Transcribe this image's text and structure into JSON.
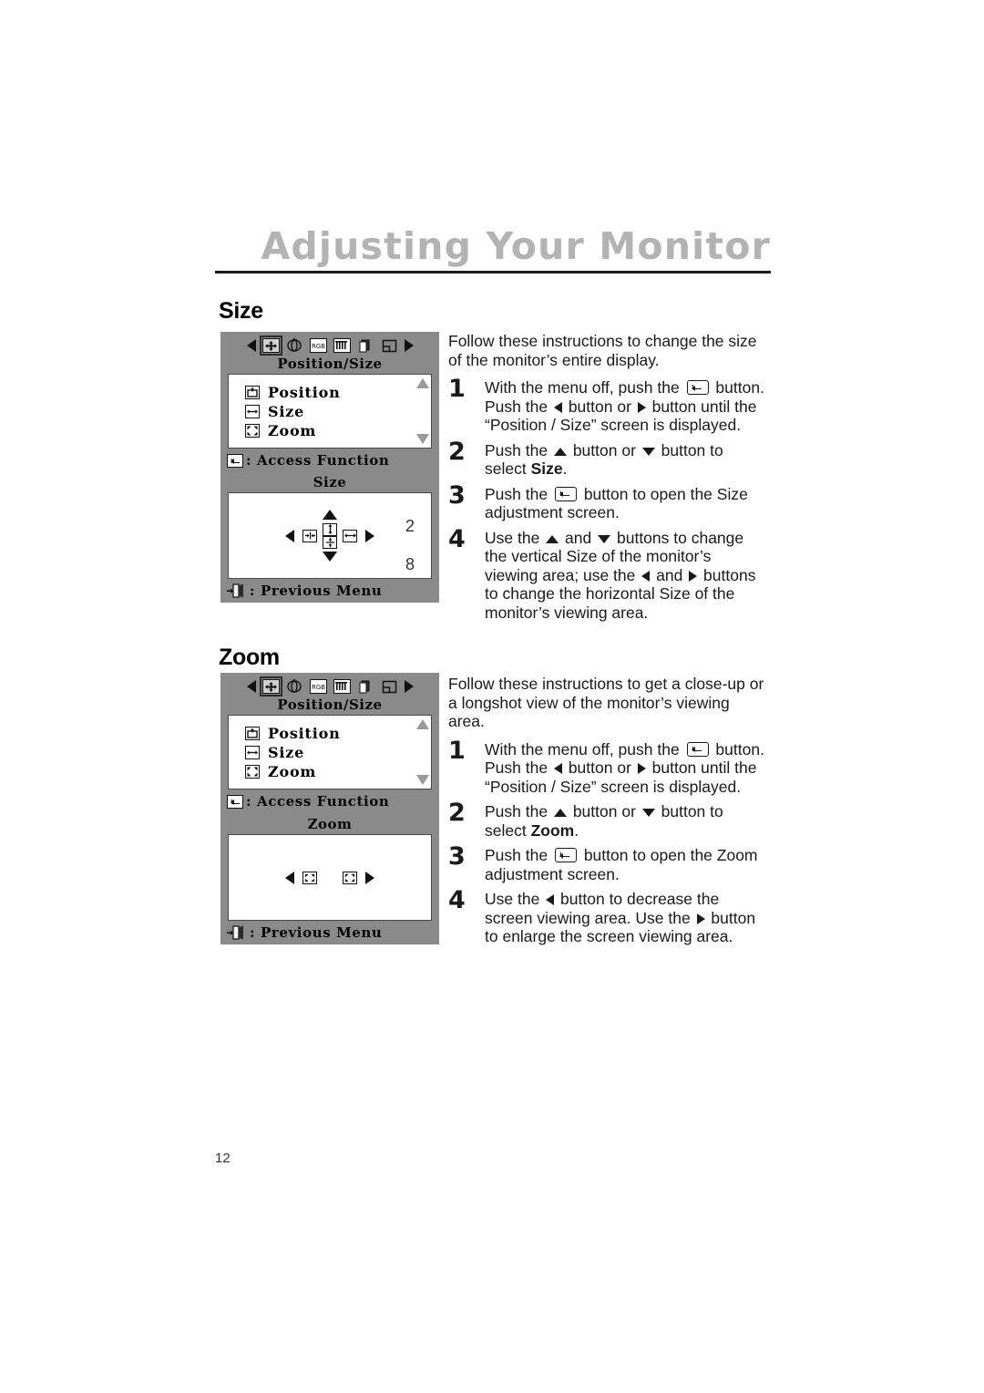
{
  "page": {
    "chapter_title": "Adjusting Your Monitor",
    "page_number": "12"
  },
  "sections": [
    {
      "heading": "Size",
      "lead": "Follow these instructions to change the size of the monitor’s entire display.",
      "menu_screen": {
        "title": "Position/Size",
        "icons": [
          "left-arrow",
          "position-size-icon",
          "geometry-icon",
          "rgb-icon",
          "moire-icon",
          "osd-icon",
          "screen-icon",
          "right-arrow"
        ],
        "selected_icon": "position-size-icon",
        "items": [
          {
            "label": "Position",
            "icon": "position-icon"
          },
          {
            "label": "Size",
            "icon": "size-icon"
          },
          {
            "label": "Zoom",
            "icon": "zoom-icon"
          }
        ],
        "footer": ": Access Function"
      },
      "adjust_screen": {
        "title": "Size",
        "footer": ": Previous Menu",
        "value_top": "2",
        "value_bottom": "8",
        "controls": [
          "v-expand",
          "h-shrink",
          "h-expand",
          "v-shrink"
        ]
      },
      "steps": [
        {
          "num": "1",
          "parts": [
            {
              "t": "With the menu off, push the "
            },
            {
              "g": "enter"
            },
            {
              "t": " button. Push the "
            },
            {
              "g": "left"
            },
            {
              "t": " button or "
            },
            {
              "g": "right"
            },
            {
              "t": " button until the “Position / Size” screen is displayed."
            }
          ]
        },
        {
          "num": "2",
          "parts": [
            {
              "t": "Push the "
            },
            {
              "g": "up"
            },
            {
              "t": " button or "
            },
            {
              "g": "down"
            },
            {
              "t": " button to select "
            },
            {
              "t": "Size",
              "b": true
            },
            {
              "t": "."
            }
          ]
        },
        {
          "num": "3",
          "parts": [
            {
              "t": "Push the "
            },
            {
              "g": "enter"
            },
            {
              "t": " button to open the Size adjustment screen."
            }
          ]
        },
        {
          "num": "4",
          "parts": [
            {
              "t": "Use the "
            },
            {
              "g": "up"
            },
            {
              "t": " and "
            },
            {
              "g": "down"
            },
            {
              "t": " buttons to change the vertical Size of the monitor’s viewing area; use the "
            },
            {
              "g": "left"
            },
            {
              "t": " and "
            },
            {
              "g": "right"
            },
            {
              "t": " buttons to change the horizontal Size of the monitor’s viewing area."
            }
          ]
        }
      ]
    },
    {
      "heading": "Zoom",
      "lead": "Follow these instructions to get a close-up or a longshot view of the monitor’s viewing area.",
      "menu_screen": {
        "title": "Position/Size",
        "icons": [
          "left-arrow",
          "position-size-icon",
          "geometry-icon",
          "rgb-icon",
          "moire-icon",
          "osd-icon",
          "screen-icon",
          "right-arrow"
        ],
        "selected_icon": "position-size-icon",
        "items": [
          {
            "label": "Position",
            "icon": "position-icon"
          },
          {
            "label": "Size",
            "icon": "size-icon"
          },
          {
            "label": "Zoom",
            "icon": "zoom-icon"
          }
        ],
        "footer": ": Access Function"
      },
      "adjust_screen": {
        "title": "Zoom",
        "footer": ": Previous Menu",
        "controls": [
          "zoom-out",
          "zoom-in"
        ]
      },
      "steps": [
        {
          "num": "1",
          "parts": [
            {
              "t": "With the menu off, push the "
            },
            {
              "g": "enter"
            },
            {
              "t": " button. Push the "
            },
            {
              "g": "left"
            },
            {
              "t": " button or "
            },
            {
              "g": "right"
            },
            {
              "t": " button until the “Position / Size” screen is displayed."
            }
          ]
        },
        {
          "num": "2",
          "parts": [
            {
              "t": "Push the "
            },
            {
              "g": "up"
            },
            {
              "t": " button or "
            },
            {
              "g": "down"
            },
            {
              "t": " button to select "
            },
            {
              "t": "Zoom",
              "b": true
            },
            {
              "t": "."
            }
          ]
        },
        {
          "num": "3",
          "parts": [
            {
              "t": "Push the "
            },
            {
              "g": "enter"
            },
            {
              "t": " button to open the Zoom adjustment screen."
            }
          ]
        },
        {
          "num": "4",
          "parts": [
            {
              "t": "Use the "
            },
            {
              "g": "left"
            },
            {
              "t": " button to decrease the screen viewing area. Use the "
            },
            {
              "g": "right"
            },
            {
              "t": " button to enlarge the screen viewing area."
            }
          ]
        }
      ]
    }
  ],
  "colors": {
    "osd_panel": "#8a8a8a",
    "osd_body": "#ffffff",
    "title_gray": "#b3b3b3",
    "text": "#1a1a1a"
  }
}
